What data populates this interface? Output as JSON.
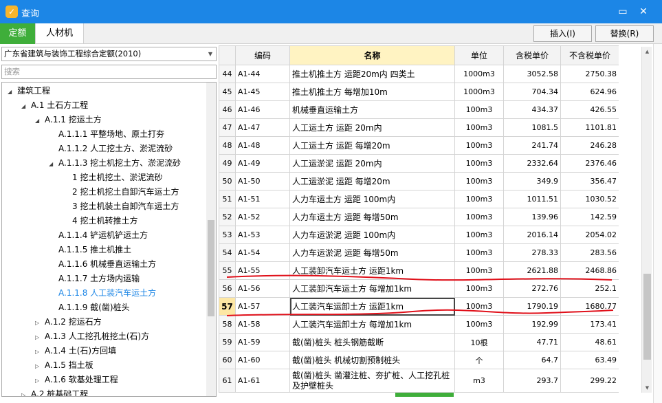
{
  "window": {
    "title": "查询",
    "icon": "app-icon"
  },
  "tabs": [
    {
      "label": "定额",
      "active": true
    },
    {
      "label": "人材机",
      "active": false
    }
  ],
  "toolbar": {
    "insert_label": "插入(I)",
    "replace_label": "替换(R)"
  },
  "library_select": {
    "value": "广东省建筑与装饰工程综合定额(2010)"
  },
  "search": {
    "placeholder": "搜索"
  },
  "tree": [
    {
      "label": "建筑工程",
      "level": 0,
      "exp": "◢"
    },
    {
      "label": "A.1 土石方工程",
      "level": 1,
      "exp": "◢"
    },
    {
      "label": "A.1.1 挖运土方",
      "level": 2,
      "exp": "◢"
    },
    {
      "label": "A.1.1.1 平整场地、原土打夯",
      "level": 3,
      "exp": ""
    },
    {
      "label": "A.1.1.2 人工挖土方、淤泥流砂",
      "level": 3,
      "exp": ""
    },
    {
      "label": "A.1.1.3 挖土机挖土方、淤泥流砂",
      "level": 3,
      "exp": "◢"
    },
    {
      "label": "1 挖土机挖土、淤泥流砂",
      "level": 4,
      "exp": ""
    },
    {
      "label": "2 挖土机挖土自卸汽车运土方",
      "level": 4,
      "exp": ""
    },
    {
      "label": "3 挖土机装土自卸汽车运土方",
      "level": 4,
      "exp": ""
    },
    {
      "label": "4 挖土机转推土方",
      "level": 4,
      "exp": ""
    },
    {
      "label": "A.1.1.4 铲运机铲运土方",
      "level": 3,
      "exp": ""
    },
    {
      "label": "A.1.1.5 推土机推土",
      "level": 3,
      "exp": ""
    },
    {
      "label": "A.1.1.6 机械垂直运输土方",
      "level": 3,
      "exp": ""
    },
    {
      "label": "A.1.1.7 土方场内运输",
      "level": 3,
      "exp": ""
    },
    {
      "label": "A.1.1.8 人工装汽车运土方",
      "level": 3,
      "exp": "",
      "selected": true
    },
    {
      "label": "A.1.1.9 截(凿)桩头",
      "level": 3,
      "exp": ""
    },
    {
      "label": "A.1.2 挖运石方",
      "level": 2,
      "exp": "▷"
    },
    {
      "label": "A.1.3 人工挖孔桩挖土(石)方",
      "level": 2,
      "exp": "▷"
    },
    {
      "label": "A.1.4 土(石)方回填",
      "level": 2,
      "exp": "▷"
    },
    {
      "label": "A.1.5 挡土板",
      "level": 2,
      "exp": "▷"
    },
    {
      "label": "A.1.6 软基处理工程",
      "level": 2,
      "exp": "▷"
    },
    {
      "label": "A.2 桩基础工程",
      "level": 1,
      "exp": "▷"
    }
  ],
  "grid": {
    "headers": [
      "",
      "编码",
      "名称",
      "单位",
      "含税单价",
      "不含税单价"
    ],
    "rows": [
      {
        "no": "44",
        "code": "A1-44",
        "name": "推土机推土方 运距20m内 四类土",
        "unit": "1000m3",
        "tax": "3052.58",
        "notax": "2750.38"
      },
      {
        "no": "45",
        "code": "A1-45",
        "name": "推土机推土方 每增加10m",
        "unit": "1000m3",
        "tax": "704.34",
        "notax": "624.96"
      },
      {
        "no": "46",
        "code": "A1-46",
        "name": "机械垂直运输土方",
        "unit": "100m3",
        "tax": "434.37",
        "notax": "426.55"
      },
      {
        "no": "47",
        "code": "A1-47",
        "name": "人工运土方 运距 20m内",
        "unit": "100m3",
        "tax": "1081.5",
        "notax": "1101.81"
      },
      {
        "no": "48",
        "code": "A1-48",
        "name": "人工运土方 运距 每增20m",
        "unit": "100m3",
        "tax": "241.74",
        "notax": "246.28"
      },
      {
        "no": "49",
        "code": "A1-49",
        "name": "人工运淤泥 运距 20m内",
        "unit": "100m3",
        "tax": "2332.64",
        "notax": "2376.46"
      },
      {
        "no": "50",
        "code": "A1-50",
        "name": "人工运淤泥 运距 每增20m",
        "unit": "100m3",
        "tax": "349.9",
        "notax": "356.47"
      },
      {
        "no": "51",
        "code": "A1-51",
        "name": "人力车运土方 运距 100m内",
        "unit": "100m3",
        "tax": "1011.51",
        "notax": "1030.52"
      },
      {
        "no": "52",
        "code": "A1-52",
        "name": "人力车运土方 运距 每增50m",
        "unit": "100m3",
        "tax": "139.96",
        "notax": "142.59"
      },
      {
        "no": "53",
        "code": "A1-53",
        "name": "人力车运淤泥 运距 100m内",
        "unit": "100m3",
        "tax": "2016.14",
        "notax": "2054.02"
      },
      {
        "no": "54",
        "code": "A1-54",
        "name": "人力车运淤泥 运距 每增50m",
        "unit": "100m3",
        "tax": "278.33",
        "notax": "283.56"
      },
      {
        "no": "55",
        "code": "A1-55",
        "name": "人工装卸汽车运土方 运距1km",
        "unit": "100m3",
        "tax": "2621.88",
        "notax": "2468.86"
      },
      {
        "no": "56",
        "code": "A1-56",
        "name": "人工装卸汽车运土方 每增加1km",
        "unit": "100m3",
        "tax": "272.76",
        "notax": "252.1"
      },
      {
        "no": "57",
        "code": "A1-57",
        "name": "人工装汽车运卸土方 运距1km",
        "unit": "100m3",
        "tax": "1790.19",
        "notax": "1680.77",
        "active": true
      },
      {
        "no": "58",
        "code": "A1-58",
        "name": "人工装汽车运卸土方 每增加1km",
        "unit": "100m3",
        "tax": "192.99",
        "notax": "173.41"
      },
      {
        "no": "59",
        "code": "A1-59",
        "name": "截(凿)桩头 桩头钢筋截断",
        "unit": "10根",
        "tax": "47.71",
        "notax": "48.61"
      },
      {
        "no": "60",
        "code": "A1-60",
        "name": "截(凿)桩头 机械切割预制桩头",
        "unit": "个",
        "tax": "64.7",
        "notax": "63.49"
      },
      {
        "no": "61",
        "code": "A1-61",
        "name": "截(凿)桩头 凿灌注桩、夯扩桩、人工挖孔桩及护壁桩头",
        "unit": "m3",
        "tax": "293.7",
        "notax": "299.22",
        "tall": true
      }
    ]
  }
}
